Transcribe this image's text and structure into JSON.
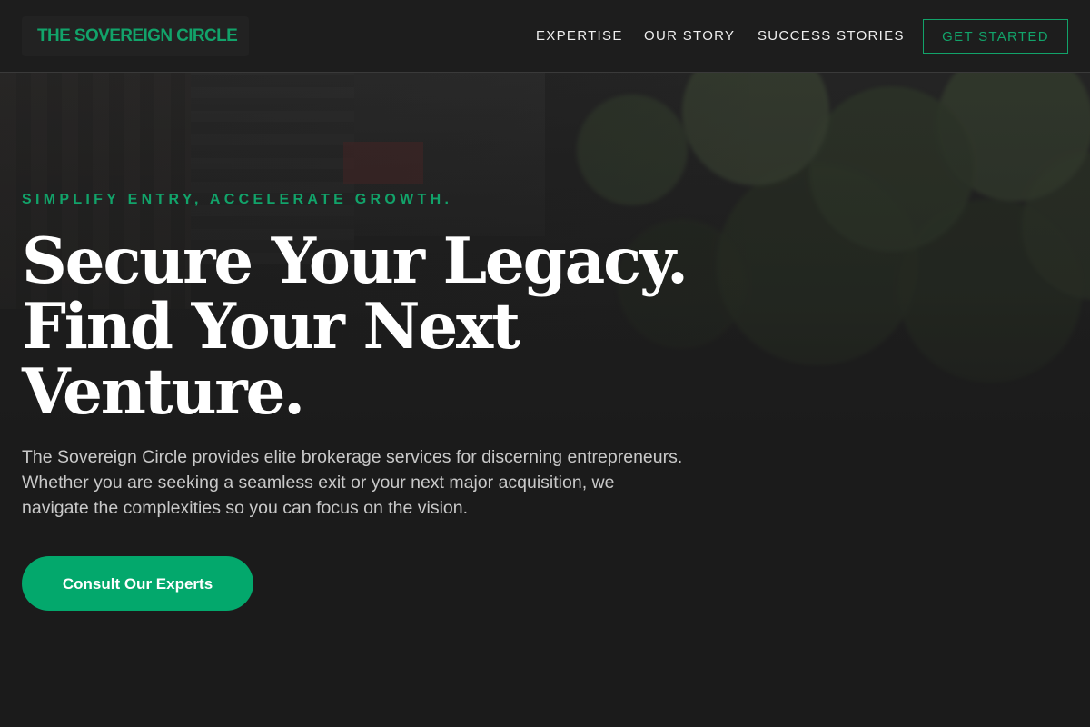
{
  "header": {
    "logo_text": "THE SOVEREIGN CIRCLE",
    "nav": [
      {
        "label": "EXPERTISE"
      },
      {
        "label": "OUR STORY"
      },
      {
        "label": "SUCCESS STORIES"
      }
    ],
    "cta_label": "GET STARTED"
  },
  "hero": {
    "eyebrow": "SIMPLIFY ENTRY, ACCELERATE GROWTH.",
    "headline_lines": [
      "Secure Your Legacy.",
      "Find Your Next",
      "Venture."
    ],
    "lead": "The Sovereign Circle provides elite brokerage services for discerning entrepreneurs. Whether you are seeking a seamless exit or your next major acquisition, we navigate the complexities so you can focus on the vision.",
    "cta_label": "Consult Our Experts",
    "background_image": "street-with-trees-photo"
  },
  "colors": {
    "accent": "#12a36a",
    "button_fill": "#03a86c",
    "background": "#1b1b1b",
    "header_bg": "#1d1d1d",
    "text_primary": "#ffffff",
    "text_secondary": "#c9c9c9"
  }
}
